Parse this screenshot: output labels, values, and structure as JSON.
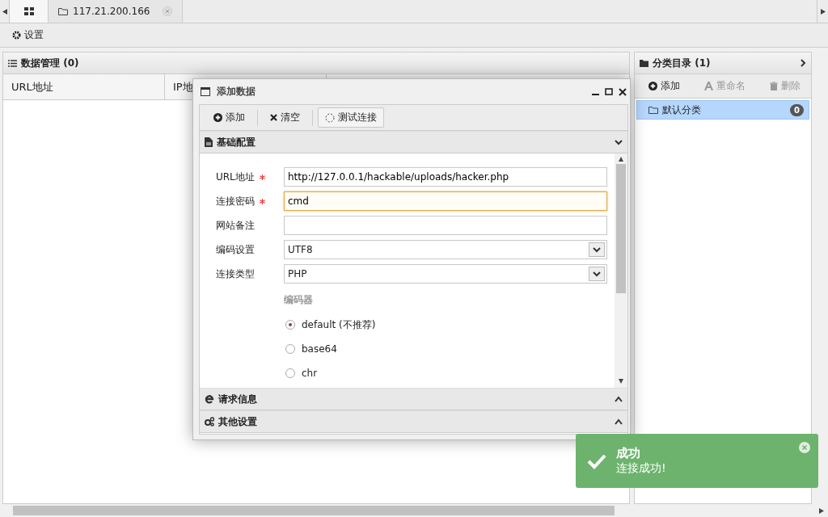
{
  "tabs": [
    {
      "kind": "home",
      "selected": true
    },
    {
      "kind": "host",
      "label": "117.21.200.166",
      "selected": false
    }
  ],
  "toolbar": {
    "settings": "设置"
  },
  "data_panel": {
    "title": "数据管理 (0)",
    "columns": [
      "URL地址",
      "IP地"
    ]
  },
  "category_panel": {
    "title": "分类目录 (1)",
    "actions": [
      {
        "label": "添加",
        "disabled": false
      },
      {
        "label": "重命名",
        "disabled": true
      },
      {
        "label": "删除",
        "disabled": true
      }
    ],
    "items": [
      {
        "label": "默认分类",
        "count": "0",
        "selected": true
      }
    ]
  },
  "dialog": {
    "title": "添加数据",
    "actions": [
      {
        "label": "添加",
        "pressed": false
      },
      {
        "label": "清空",
        "pressed": false
      },
      {
        "label": "测试连接",
        "pressed": true
      }
    ],
    "sections": [
      {
        "title": "基础配置",
        "expanded": true
      },
      {
        "title": "请求信息",
        "expanded": false
      },
      {
        "title": "其他设置",
        "expanded": false
      }
    ],
    "fields": [
      {
        "kind": "text",
        "label": "URL地址",
        "required": true,
        "value": "http://127.0.0.1/hackable/uploads/hacker.php",
        "focused": false
      },
      {
        "kind": "text",
        "label": "连接密码",
        "required": true,
        "value": "cmd",
        "focused": true
      },
      {
        "kind": "text",
        "label": "网站备注",
        "required": false,
        "focused": false
      },
      {
        "kind": "select",
        "label": "编码设置",
        "required": false,
        "value": "UTF8"
      },
      {
        "kind": "select",
        "label": "连接类型",
        "required": false,
        "value": "PHP"
      }
    ],
    "encoder": {
      "title": "编码器",
      "options": [
        {
          "label": "default (不推荐)",
          "selected": true
        },
        {
          "label": "base64",
          "selected": false
        },
        {
          "label": "chr",
          "selected": false
        }
      ]
    }
  },
  "toast": {
    "title": "成功",
    "message": "连接成功!"
  }
}
